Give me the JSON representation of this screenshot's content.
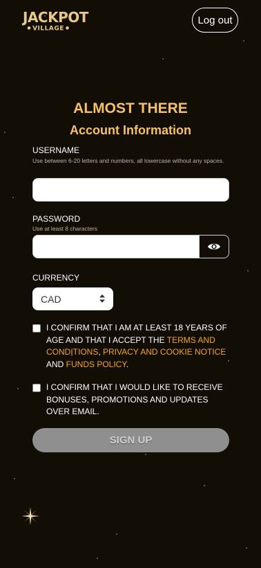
{
  "header": {
    "logo_top": "JACKPOT",
    "logo_bottom": "VILLAGE",
    "logout_label": "Log out"
  },
  "form": {
    "title": "ALMOST THERE",
    "subtitle": "Account Information",
    "username": {
      "label": "USERNAME",
      "hint": "Use between 6-20 letters and numbers, all lowercase without any spaces.",
      "value": ""
    },
    "password": {
      "label": "PASSWORD",
      "hint": "Use at least 8 characters",
      "value": "",
      "toggle_icon": "eye-icon"
    },
    "currency": {
      "label": "CURRENCY",
      "selected": "CAD"
    },
    "age_confirm": {
      "text_1": "I CONFIRM THAT I AM AT LEAST 18 YEARS OF AGE AND THAT I ACCEPT THE ",
      "link_terms": "TERMS AND CONDITIONS",
      "sep_1": ", ",
      "link_privacy": "PRIVACY AND COOKIE NOTICE",
      "sep_2": " AND ",
      "link_funds": "FUNDS POLICY",
      "end": ".",
      "checked": false
    },
    "promo_confirm": {
      "text": "I CONFIRM THAT I WOULD LIKE TO RECEIVE BONUSES, PROMOTIONS AND UPDATES OVER EMAIL.",
      "checked": false
    },
    "signup_label": "SIGN UP"
  },
  "colors": {
    "background": "#120d05",
    "accent": "#f5c26b",
    "link": "#f5a623",
    "button_disabled": "#8f8f8f"
  }
}
